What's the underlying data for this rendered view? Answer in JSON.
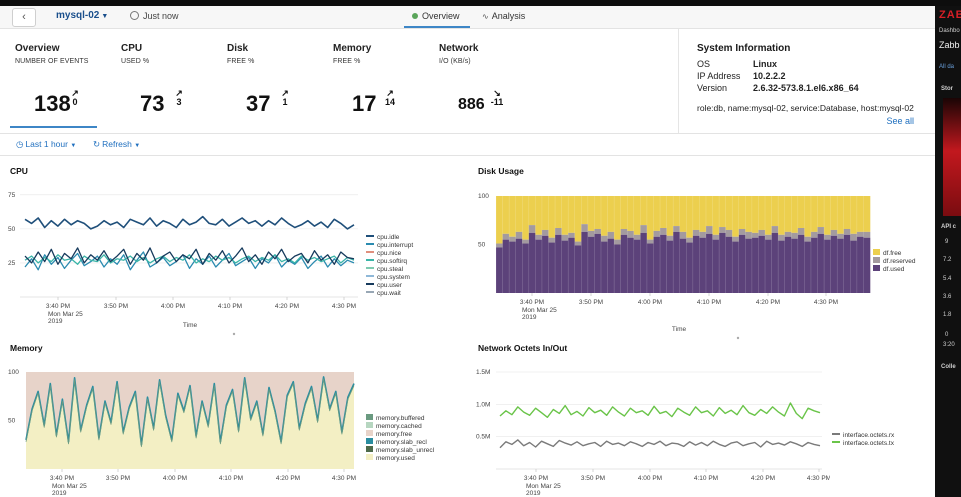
{
  "nav": {
    "host": "mysql-02",
    "timestamp": "Just now",
    "tabs": [
      {
        "label": "Overview",
        "active": true
      },
      {
        "label": "Analysis",
        "active": false
      }
    ]
  },
  "kpis": [
    {
      "title": "Overview",
      "subtitle": "NUMBER OF EVENTS",
      "value": "138",
      "trend_arrow": "↗",
      "trend_value": "0"
    },
    {
      "title": "CPU",
      "subtitle": "USED %",
      "value": "73",
      "trend_arrow": "↗",
      "trend_value": "3"
    },
    {
      "title": "Disk",
      "subtitle": "FREE %",
      "value": "37",
      "trend_arrow": "↗",
      "trend_value": "1"
    },
    {
      "title": "Memory",
      "subtitle": "FREE %",
      "value": "17",
      "trend_arrow": "↗",
      "trend_value": "14"
    },
    {
      "title": "Network",
      "subtitle": "I/O (KB/s)",
      "value": "886",
      "trend_arrow": "↘",
      "trend_value": "-11"
    }
  ],
  "sysinfo": {
    "title": "System Information",
    "os_label": "OS",
    "os": "Linux",
    "ip_label": "IP Address",
    "ip": "10.2.2.2",
    "version_label": "Version",
    "version": "2.6.32-573.8.1.el6.x86_64",
    "tags": "role:db, name:mysql-02, service:Database, host:mysql-02",
    "see_all": "See all"
  },
  "timebar": {
    "range": "Last 1 hour",
    "refresh": "Refresh"
  },
  "colors": {
    "accent": "#3d86c6",
    "link": "#1f6fbf",
    "disk_free": "#eccf4e",
    "disk_reserved": "#a39a9f",
    "disk_used": "#5c427a",
    "net_rx": "#7a7a7a",
    "net_tx": "#6ac449"
  },
  "x_time_labels": [
    "3:40 PM",
    "3:50 PM",
    "4:00 PM",
    "4:10 PM",
    "4:20 PM",
    "4:30 PM"
  ],
  "x_date_sub": [
    "Mon Mar 25",
    "2019"
  ],
  "x_axis_label": "Time",
  "chart_data": [
    {
      "type": "line",
      "title": "CPU",
      "xlabel": "Time",
      "x": [
        "3:40 PM",
        "3:50 PM",
        "4:00 PM",
        "4:10 PM",
        "4:20 PM",
        "4:30 PM"
      ],
      "ylim": [
        0,
        80
      ],
      "yticks": [
        25,
        50,
        75
      ],
      "series": [
        {
          "name": "cpu.idle",
          "color": "#1f4f7a",
          "values": [
            57,
            54,
            58,
            51,
            56,
            52,
            57,
            53,
            56,
            54,
            50,
            52,
            56,
            53,
            55,
            51,
            57,
            55,
            53,
            58,
            52,
            56,
            54,
            51,
            57,
            53,
            55,
            59,
            54,
            53,
            57,
            52,
            55,
            58,
            54,
            56,
            52,
            56,
            53,
            58,
            54,
            51,
            53,
            56,
            52,
            55,
            51,
            57,
            54,
            50,
            53
          ]
        },
        {
          "name": "cpu.interrupt",
          "color": "#2b8bb0",
          "values": [
            22,
            28,
            20,
            31,
            24,
            29,
            21,
            27,
            32,
            23,
            26,
            30,
            22,
            28,
            24,
            31,
            20,
            27,
            33,
            22,
            25,
            29,
            23,
            26,
            31,
            21,
            28,
            24,
            30,
            22,
            27,
            32,
            23,
            26,
            29,
            21,
            28,
            25,
            31,
            22,
            27,
            24,
            29,
            21,
            26,
            30,
            22,
            28,
            23,
            27,
            25
          ]
        },
        {
          "name": "cpu.nice",
          "color": "#e08f7d",
          "values": []
        },
        {
          "name": "cpu.softirq",
          "color": "#3ab5a8",
          "values": [
            27,
            30,
            25,
            29,
            26,
            31,
            27,
            28,
            24,
            30,
            27,
            26,
            31,
            25,
            28,
            27,
            30,
            26,
            29,
            25,
            28,
            30,
            26,
            29,
            27,
            31,
            25,
            28,
            26,
            30,
            27,
            29,
            25,
            28,
            30,
            26,
            29,
            27,
            31,
            26,
            28,
            25,
            30,
            27,
            29,
            26,
            28,
            30,
            25,
            29,
            27
          ]
        },
        {
          "name": "cpu.steal",
          "color": "#7fcab0",
          "values": []
        },
        {
          "name": "cpu.system",
          "color": "#8fb8d8",
          "values": []
        },
        {
          "name": "cpu.user",
          "color": "#163a5c",
          "values": [
            30,
            25,
            33,
            26,
            35,
            24,
            32,
            28,
            36,
            25,
            31,
            27,
            34,
            26,
            30,
            35,
            24,
            32,
            27,
            36,
            25,
            30,
            33,
            26,
            31,
            28,
            35,
            24,
            32,
            27,
            34,
            25,
            30,
            36,
            26,
            31,
            24,
            33,
            28,
            35,
            26,
            30,
            32,
            25,
            34,
            27,
            31,
            24,
            33,
            29,
            28
          ]
        },
        {
          "name": "cpu.wait",
          "color": "#98a7b5",
          "values": []
        }
      ]
    },
    {
      "type": "area",
      "title": "Disk Usage",
      "xlabel": "Time",
      "x": [
        "3:40 PM",
        "3:50 PM",
        "4:00 PM",
        "4:10 PM",
        "4:20 PM",
        "4:30 PM"
      ],
      "ylim": [
        0,
        100
      ],
      "yticks": [
        50,
        100
      ],
      "series": [
        {
          "name": "df.free",
          "color": "#eccf4e"
        },
        {
          "name": "df.reserved",
          "color": "#a39a9f"
        },
        {
          "name": "df.used",
          "color": "#5c427a",
          "values": [
            47,
            55,
            53,
            56,
            51,
            62,
            55,
            59,
            52,
            60,
            54,
            57,
            49,
            63,
            58,
            61,
            53,
            56,
            50,
            60,
            57,
            55,
            62,
            51,
            58,
            60,
            54,
            63,
            56,
            52,
            59,
            57,
            61,
            55,
            62,
            58,
            53,
            60,
            56,
            57,
            59,
            55,
            62,
            54,
            58,
            56,
            60,
            53,
            57,
            61,
            55,
            59,
            56,
            60,
            54,
            58,
            57
          ]
        },
        {
          "name": "df.reserved_band",
          "color": "#a39a9f",
          "values": [
            4,
            6,
            5,
            7,
            4,
            8,
            5,
            6,
            5,
            7,
            6,
            5,
            4,
            8,
            6,
            5,
            6,
            7,
            5,
            6,
            7,
            5,
            8,
            4,
            6,
            7,
            5,
            6,
            7,
            5,
            6,
            6,
            8,
            5,
            6,
            7,
            5,
            6,
            7,
            5,
            6,
            5,
            7,
            6,
            5,
            6,
            7,
            5,
            6,
            7,
            5,
            6,
            5,
            6,
            7,
            5,
            6
          ]
        }
      ]
    },
    {
      "type": "line",
      "title": "Memory",
      "xlabel": "Time",
      "x": [
        "3:40 PM",
        "3:50 PM",
        "4:00 PM",
        "4:10 PM",
        "4:20 PM",
        "4:30 PM"
      ],
      "ylim": [
        0,
        100
      ],
      "yticks": [
        50,
        100
      ],
      "series": [
        {
          "name": "memory.buffered",
          "color": "#6a9a80"
        },
        {
          "name": "memory.cached",
          "color": "#b6d6c0"
        },
        {
          "name": "memory.free",
          "color": "#e7d3c9"
        },
        {
          "name": "memory.slab_recl",
          "color": "#2a8da0",
          "values": [
            30,
            62,
            80,
            45,
            88,
            35,
            72,
            28,
            94,
            40,
            66,
            85,
            32,
            70,
            48,
            90,
            38,
            64,
            80,
            25,
            74,
            42,
            92,
            55,
            30,
            78,
            60,
            86,
            34,
            70,
            45,
            88,
            28,
            66,
            82,
            40,
            94,
            52,
            70,
            36,
            84,
            60,
            28,
            76,
            90,
            42,
            68,
            85,
            50,
            95,
            62,
            80,
            38,
            74,
            88
          ]
        },
        {
          "name": "memory.slab_unrecl",
          "color": "#4e6a4a"
        },
        {
          "name": "memory.used",
          "color": "#f3efc4"
        }
      ]
    },
    {
      "type": "line",
      "title": "Network Octets In/Out",
      "xlabel": "Time",
      "x": [
        "3:40 PM",
        "3:50 PM",
        "4:00 PM",
        "4:10 PM",
        "4:20 PM",
        "4:30 PM"
      ],
      "ylim": [
        0,
        1500000
      ],
      "yticks": [
        500000,
        1000000,
        1500000
      ],
      "ytick_labels": [
        "0.5M",
        "1.0M",
        "1.5M"
      ],
      "series": [
        {
          "name": "interface.octets.rx",
          "color": "#7a7a7a",
          "values": [
            330000,
            420000,
            380000,
            450000,
            360000,
            410000,
            340000,
            430000,
            390000,
            350000,
            440000,
            400000,
            370000,
            420000,
            360000,
            390000,
            410000,
            350000,
            430000,
            380000,
            400000,
            360000,
            420000,
            390000,
            350000,
            410000,
            380000,
            430000,
            360000,
            400000,
            390000,
            350000,
            420000,
            370000,
            410000,
            360000,
            430000,
            380000,
            350000,
            400000,
            420000,
            360000,
            390000,
            410000,
            340000,
            430000,
            380000,
            400000,
            370000,
            420000,
            390000,
            350000,
            410000,
            380000,
            360000
          ]
        },
        {
          "name": "interface.octets.tx",
          "color": "#6ac449",
          "values": [
            820000,
            900000,
            840000,
            960000,
            880000,
            830000,
            940000,
            870000,
            800000,
            920000,
            860000,
            980000,
            840000,
            890000,
            820000,
            950000,
            870000,
            910000,
            830000,
            960000,
            880000,
            820000,
            940000,
            870000,
            900000,
            830000,
            970000,
            860000,
            890000,
            810000,
            940000,
            880000,
            830000,
            960000,
            870000,
            900000,
            820000,
            950000,
            860000,
            910000,
            840000,
            980000,
            870000,
            830000,
            920000,
            860000,
            960000,
            880000,
            820000,
            1020000,
            860000,
            780000,
            940000,
            900000,
            870000
          ]
        }
      ]
    }
  ],
  "sidebar": {
    "brand": "ZAB",
    "items": [
      "Dashbo",
      "Zabb",
      "All da",
      "Stor",
      "API c",
      "Colle"
    ],
    "ticks": [
      "9",
      "7.2",
      "5.4",
      "3.6",
      "1.8",
      "0",
      "3:20"
    ]
  }
}
